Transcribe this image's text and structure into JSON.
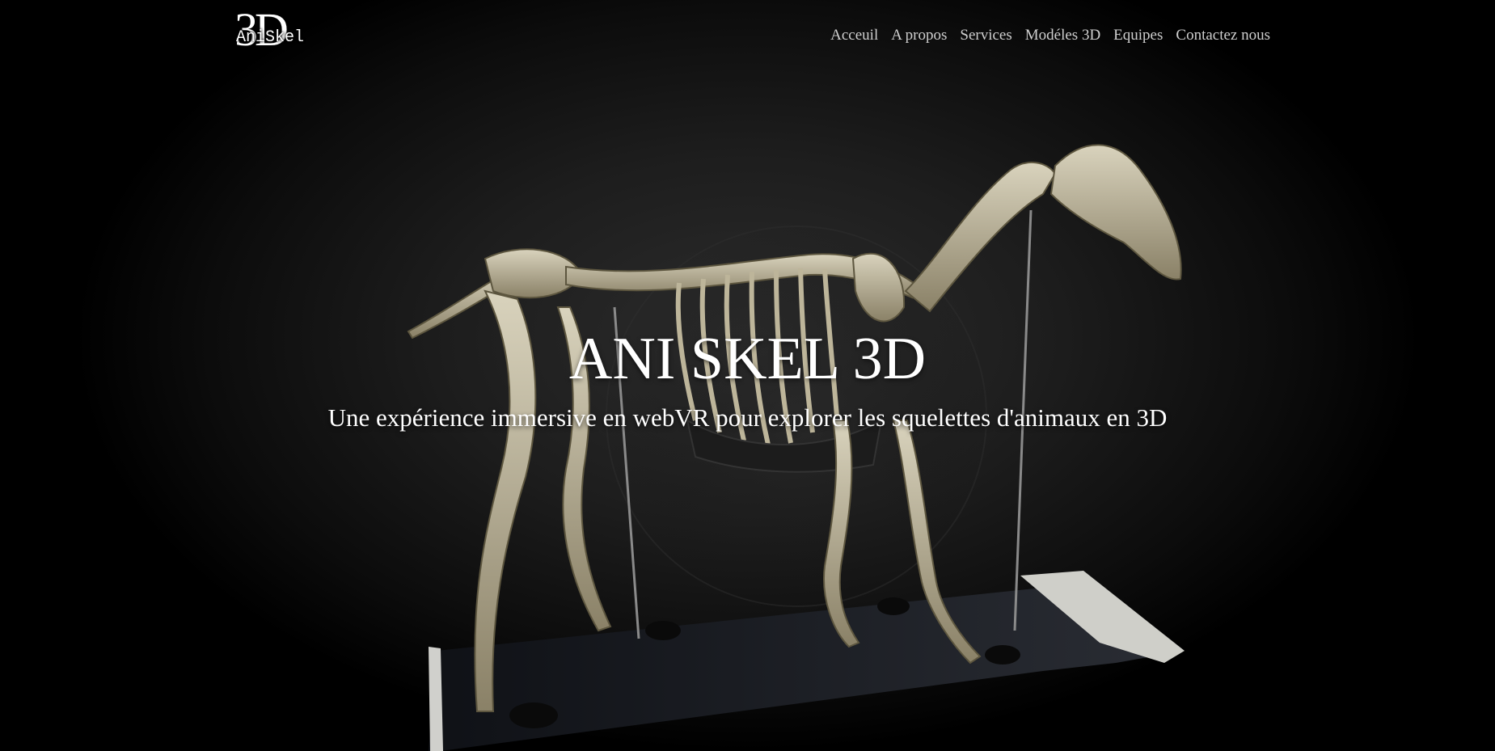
{
  "header": {
    "logo": {
      "big_text": "3D",
      "small_text": "AniSkel"
    },
    "nav": [
      {
        "label": "Acceuil"
      },
      {
        "label": "A propos"
      },
      {
        "label": "Services"
      },
      {
        "label": "Modéles 3D"
      },
      {
        "label": "Equipes"
      },
      {
        "label": "Contactez nous"
      }
    ]
  },
  "hero": {
    "title": "ANI SKEL 3D",
    "subtitle": "Une expérience immersive en webVR pour explorer les squelettes d'animaux en 3D",
    "image": "horse-skeleton-image"
  },
  "colors": {
    "background": "#000000",
    "text": "#ffffff",
    "nav_text": "#cfcfcf"
  }
}
